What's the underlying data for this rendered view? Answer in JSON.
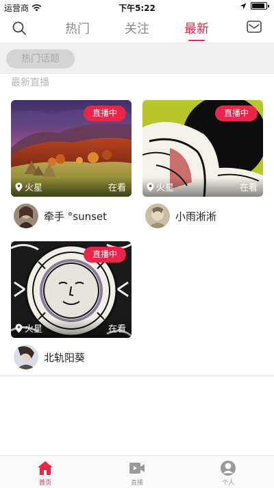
{
  "status_bar": {
    "carrier": "运营商",
    "time": "下午5:22",
    "battery_level": 0.9
  },
  "nav": {
    "search_icon": "search-icon",
    "tabs": [
      {
        "label": "热门",
        "active": false
      },
      {
        "label": "关注",
        "active": false
      },
      {
        "label": "最新",
        "active": true
      }
    ],
    "mail_icon": "mail-icon"
  },
  "topic_pill": "热门话题",
  "section_title": "最新直播",
  "cards": [
    {
      "badge": "直播中",
      "location": "火星",
      "watching": "在看",
      "user": "牵手 °sunset",
      "cover": "autumn-landscape"
    },
    {
      "badge": "直播中",
      "location": "火星",
      "watching": "在看",
      "user": "小雨淅淅",
      "cover": "pop-art"
    },
    {
      "badge": "直播中",
      "location": "火星",
      "watching": "在看",
      "user": "北轨阳葵",
      "cover": "sun-face"
    }
  ],
  "tabbar": [
    {
      "label": "首页",
      "icon": "home-icon",
      "active": true
    },
    {
      "label": "直播",
      "icon": "video-camera-icon",
      "active": false
    },
    {
      "label": "个人",
      "icon": "person-icon",
      "active": false
    }
  ],
  "colors": {
    "accent": "#e8264a",
    "topic_strip": "#efefef",
    "pill": "#d4d4d4"
  }
}
